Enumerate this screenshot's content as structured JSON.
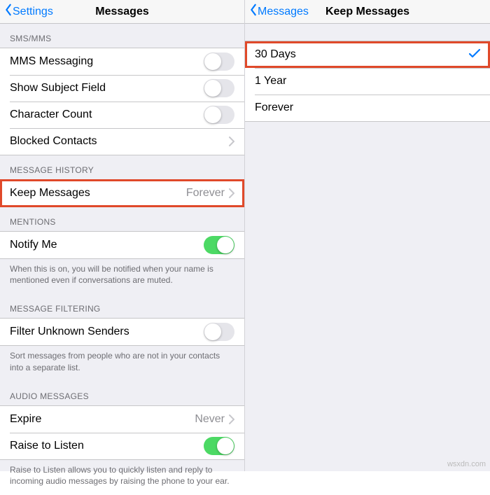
{
  "left": {
    "back": "Settings",
    "title": "Messages",
    "sms_header": "SMS/MMS",
    "mms": "MMS Messaging",
    "subject": "Show Subject Field",
    "charcount": "Character Count",
    "blocked": "Blocked Contacts",
    "history_header": "MESSAGE HISTORY",
    "keep_label": "Keep Messages",
    "keep_value": "Forever",
    "mentions_header": "MENTIONS",
    "notify": "Notify Me",
    "notify_footer": "When this is on, you will be notified when your name is mentioned even if conversations are muted.",
    "filter_header": "MESSAGE FILTERING",
    "filter": "Filter Unknown Senders",
    "filter_footer": "Sort messages from people who are not in your contacts into a separate list.",
    "audio_header": "AUDIO MESSAGES",
    "expire_label": "Expire",
    "expire_value": "Never",
    "raise": "Raise to Listen",
    "raise_footer": "Raise to Listen allows you to quickly listen and reply to incoming audio messages by raising the phone to your ear."
  },
  "right": {
    "back": "Messages",
    "title": "Keep Messages",
    "opt_30": "30 Days",
    "opt_1y": "1 Year",
    "opt_forever": "Forever"
  },
  "watermark": "wsxdn.com"
}
